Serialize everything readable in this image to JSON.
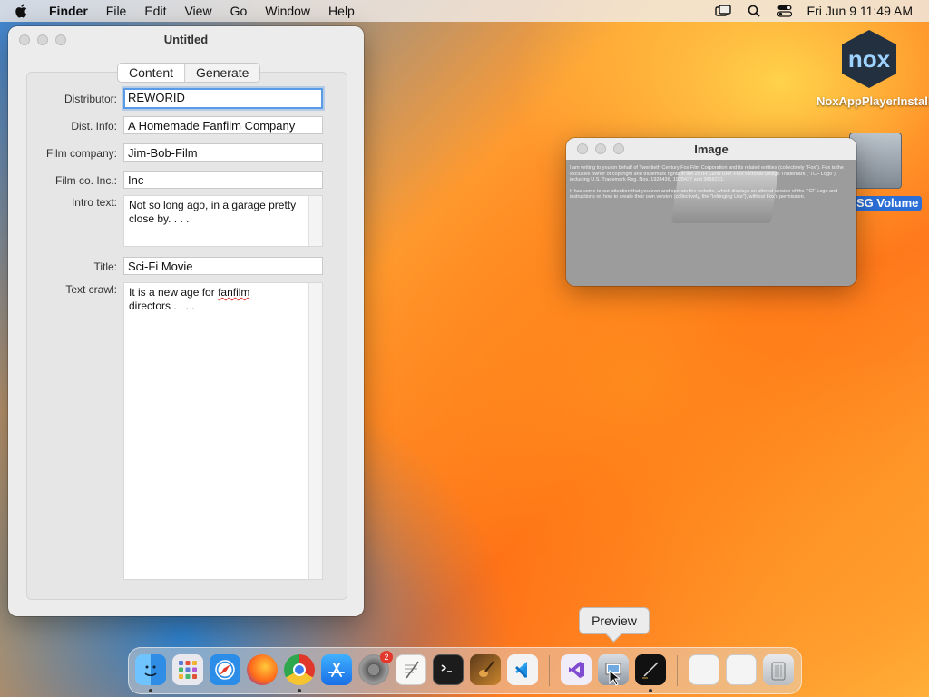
{
  "menubar": {
    "app_name": "Finder",
    "items": [
      "File",
      "Edit",
      "View",
      "Go",
      "Window",
      "Help"
    ],
    "clock": "Fri Jun 9  11:49 AM",
    "right_icons": [
      "screen-mirror-icon",
      "search-icon",
      "control-center-icon"
    ]
  },
  "main_window": {
    "title": "Untitled",
    "tabs": [
      "Content",
      "Generate"
    ],
    "active_tab": "Content",
    "fields": {
      "distributor": {
        "label": "Distributor:",
        "value": "REWORID"
      },
      "dist_info": {
        "label": "Dist. Info:",
        "value": "A Homemade Fanfilm Company"
      },
      "film_company": {
        "label": "Film company:",
        "value": "Jim-Bob-Film"
      },
      "film_co_inc": {
        "label": "Film co. Inc.:",
        "value": "Inc"
      },
      "intro_text": {
        "label": "Intro text:",
        "value": "Not so long ago, in a garage pretty close by. . . ."
      },
      "title": {
        "label": "Title:",
        "value": "Sci-Fi Movie"
      },
      "text_crawl": {
        "label": "Text crawl:",
        "line1_pre": "It is a new age for ",
        "line1_misspelled": "fanfilm",
        "line2": "directors . . . ."
      }
    }
  },
  "image_window": {
    "title": "Image",
    "para1": "I am writing to you on behalf of Twentieth Century Fox Film Corporation and its related entities (collectively \"Fox\"). Fox is the exclusive owner of copyright and trademark rights in the 20TH CENTURY FOX Pictorial Design Trademark (\"TCF Logo\"), including U.S. Trademark Reg. Nos. 1928436, 1928437 and 3658231.",
    "para2": "It has come to our attention that you own and operate the website, which displays an altered version of the TCF Logo and instructions on how to create their own version (collectively, the \"Infringing Use\"), without Fox's permission."
  },
  "desktop": {
    "nox_label": "NoxAppPlayerInstaller",
    "nox_logo_text": "nox",
    "disk_label": "SG Volume"
  },
  "dock": {
    "tooltip": "Preview",
    "settings_badge": "2",
    "apps": [
      "finder-icon",
      "launchpad-icon",
      "safari-icon",
      "firefox-icon",
      "chrome-icon",
      "app-store-icon",
      "system-settings-icon",
      "textedit-icon",
      "terminal-icon",
      "instruments-icon",
      "vscode-icon",
      "visual-studio-icon",
      "preview-icon",
      "script-editor-icon",
      "downloads-stack-icon",
      "documents-stack-icon",
      "trash-icon"
    ]
  }
}
